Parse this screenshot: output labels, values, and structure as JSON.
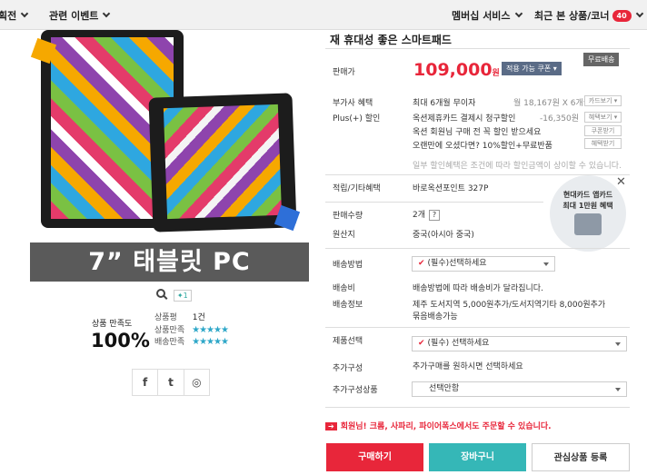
{
  "topbar": {
    "nav_left": [
      {
        "label": "획전"
      },
      {
        "label": "관련 이벤트"
      }
    ],
    "membership_label": "멤버십 서비스",
    "recent_label": "최근 본 상품/코너",
    "recent_count": "40"
  },
  "product": {
    "image_title": "7” 태블릿 PC",
    "plus_count": "1",
    "headline": "재 휴대성 좋은 스마트패드",
    "free_shipping": "무료배송"
  },
  "satisfaction": {
    "label": "상품 만족도",
    "value": "100%",
    "rows": [
      {
        "label": "상품평",
        "value": "1건"
      },
      {
        "label": "상품만족",
        "stars": "★★★★★"
      },
      {
        "label": "배송만족",
        "stars": "★★★★★"
      }
    ]
  },
  "share": {
    "facebook": "f",
    "twitter": "t",
    "other": "◎"
  },
  "price_section": {
    "label": "판매가",
    "price": "109,000",
    "unit": "원",
    "coupon_button": "적용 가능 쿠폰 ▾"
  },
  "benefits": {
    "label": "부가사 혜택",
    "installment": "최대 6개월 무이자",
    "installment_detail": "월 18,167원 X 6개월",
    "installment_btn": "카드보기 ▾",
    "plus_label": "Plus(+) 할인",
    "plus_line1": "옥션제휴카드 결제시 청구할인",
    "plus_line1_amount": "-16,350원",
    "plus_line1_btn": "혜택보기 ▾",
    "plus_line2": "옥션 회원님 구매 전 꼭 할인 받으세요",
    "plus_line2_btn": "쿠폰받기",
    "plus_line3": "오랜만에 오셨다면? 10%할인+무료반품",
    "plus_line3_btn": "혜택받기",
    "note": "일부 할인혜택은 조건에 따라 할인금액이 상이할 수 있습니다."
  },
  "points": {
    "label": "적립/기타혜택",
    "value": "바로옥션포인트 327P"
  },
  "promo": {
    "line1": "현대카드 앱카드",
    "line2": "최대 1만원 혜택",
    "close": "✕"
  },
  "quantity": {
    "label": "판매수량",
    "value": "2개",
    "help": "?"
  },
  "origin": {
    "label": "원산지",
    "value": "중국(아시아 중국)"
  },
  "shipping_method": {
    "label": "배송방법",
    "select_value": "(필수)선택하세요"
  },
  "shipping_fee": {
    "label": "배송비",
    "value": "배송방법에 따라 배송비가 달라집니다."
  },
  "shipping_info": {
    "label": "배송정보",
    "line1": "제주 도서지역 5,000원추가/도서지역기타 8,000원추가",
    "line2": "묶음배송가능"
  },
  "product_select": {
    "label": "제품선택",
    "select_value": "(필수) 선택하세요"
  },
  "additional": {
    "label": "추가구성",
    "value": "추가구매를 원하시면 선택하세요"
  },
  "additional_product": {
    "label": "추가구성상품",
    "select_value": "선택안함"
  },
  "notice": {
    "text": "회원님! 크롬, 사파리, 파이어폭스에서도 주문할 수 있습니다."
  },
  "actions": {
    "buy": "구매하기",
    "cart": "장바구니",
    "wish": "관심상품 등록"
  },
  "colors": {
    "accent_red": "#e8263a",
    "teal": "#35b7b7"
  }
}
